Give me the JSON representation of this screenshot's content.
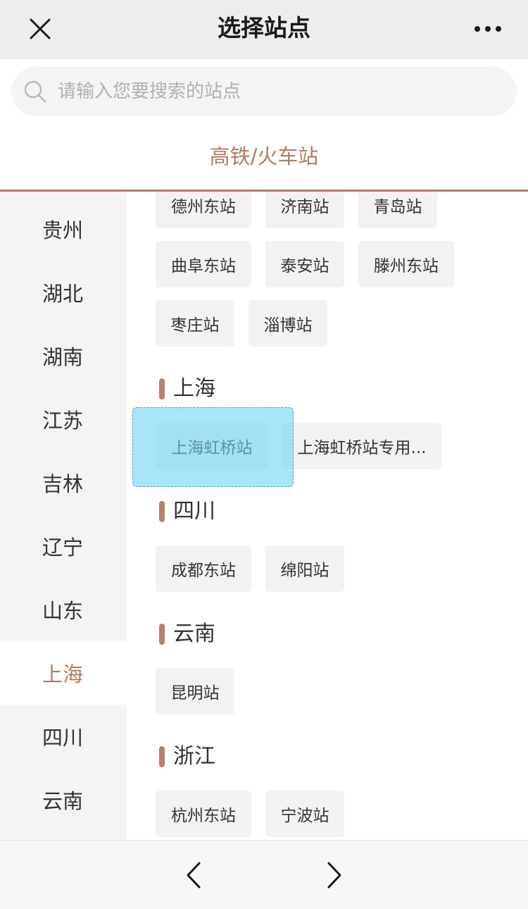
{
  "header": {
    "title": "选择站点"
  },
  "search": {
    "placeholder": "请输入您要搜索的站点"
  },
  "tab": {
    "label": "高铁/火车站"
  },
  "sidebar": {
    "items": [
      {
        "label": "贵州"
      },
      {
        "label": "湖北"
      },
      {
        "label": "湖南"
      },
      {
        "label": "江苏"
      },
      {
        "label": "吉林"
      },
      {
        "label": "辽宁"
      },
      {
        "label": "山东"
      },
      {
        "label": "上海"
      },
      {
        "label": "四川"
      },
      {
        "label": "云南"
      }
    ],
    "active": "上海"
  },
  "content": {
    "shandong": {
      "stations": [
        "德州东站",
        "济南站",
        "青岛站",
        "曲阜东站",
        "泰安站",
        "滕州东站",
        "枣庄站",
        "淄博站"
      ]
    },
    "shanghai": {
      "title": "上海",
      "stations": [
        "上海虹桥站",
        "上海虹桥站专用..."
      ]
    },
    "sichuan": {
      "title": "四川",
      "stations": [
        "成都东站",
        "绵阳站"
      ]
    },
    "yunnan": {
      "title": "云南",
      "stations": [
        "昆明站"
      ]
    },
    "zhejiang": {
      "title": "浙江",
      "stations": [
        "杭州东站",
        "宁波站"
      ]
    }
  },
  "colors": {
    "accent": "#b77a63",
    "highlight": "#70d4f5"
  },
  "icons": {
    "close": "close-icon",
    "more": "more-icon",
    "search": "search-icon",
    "back": "chevron-left-icon",
    "forward": "chevron-right-icon"
  }
}
